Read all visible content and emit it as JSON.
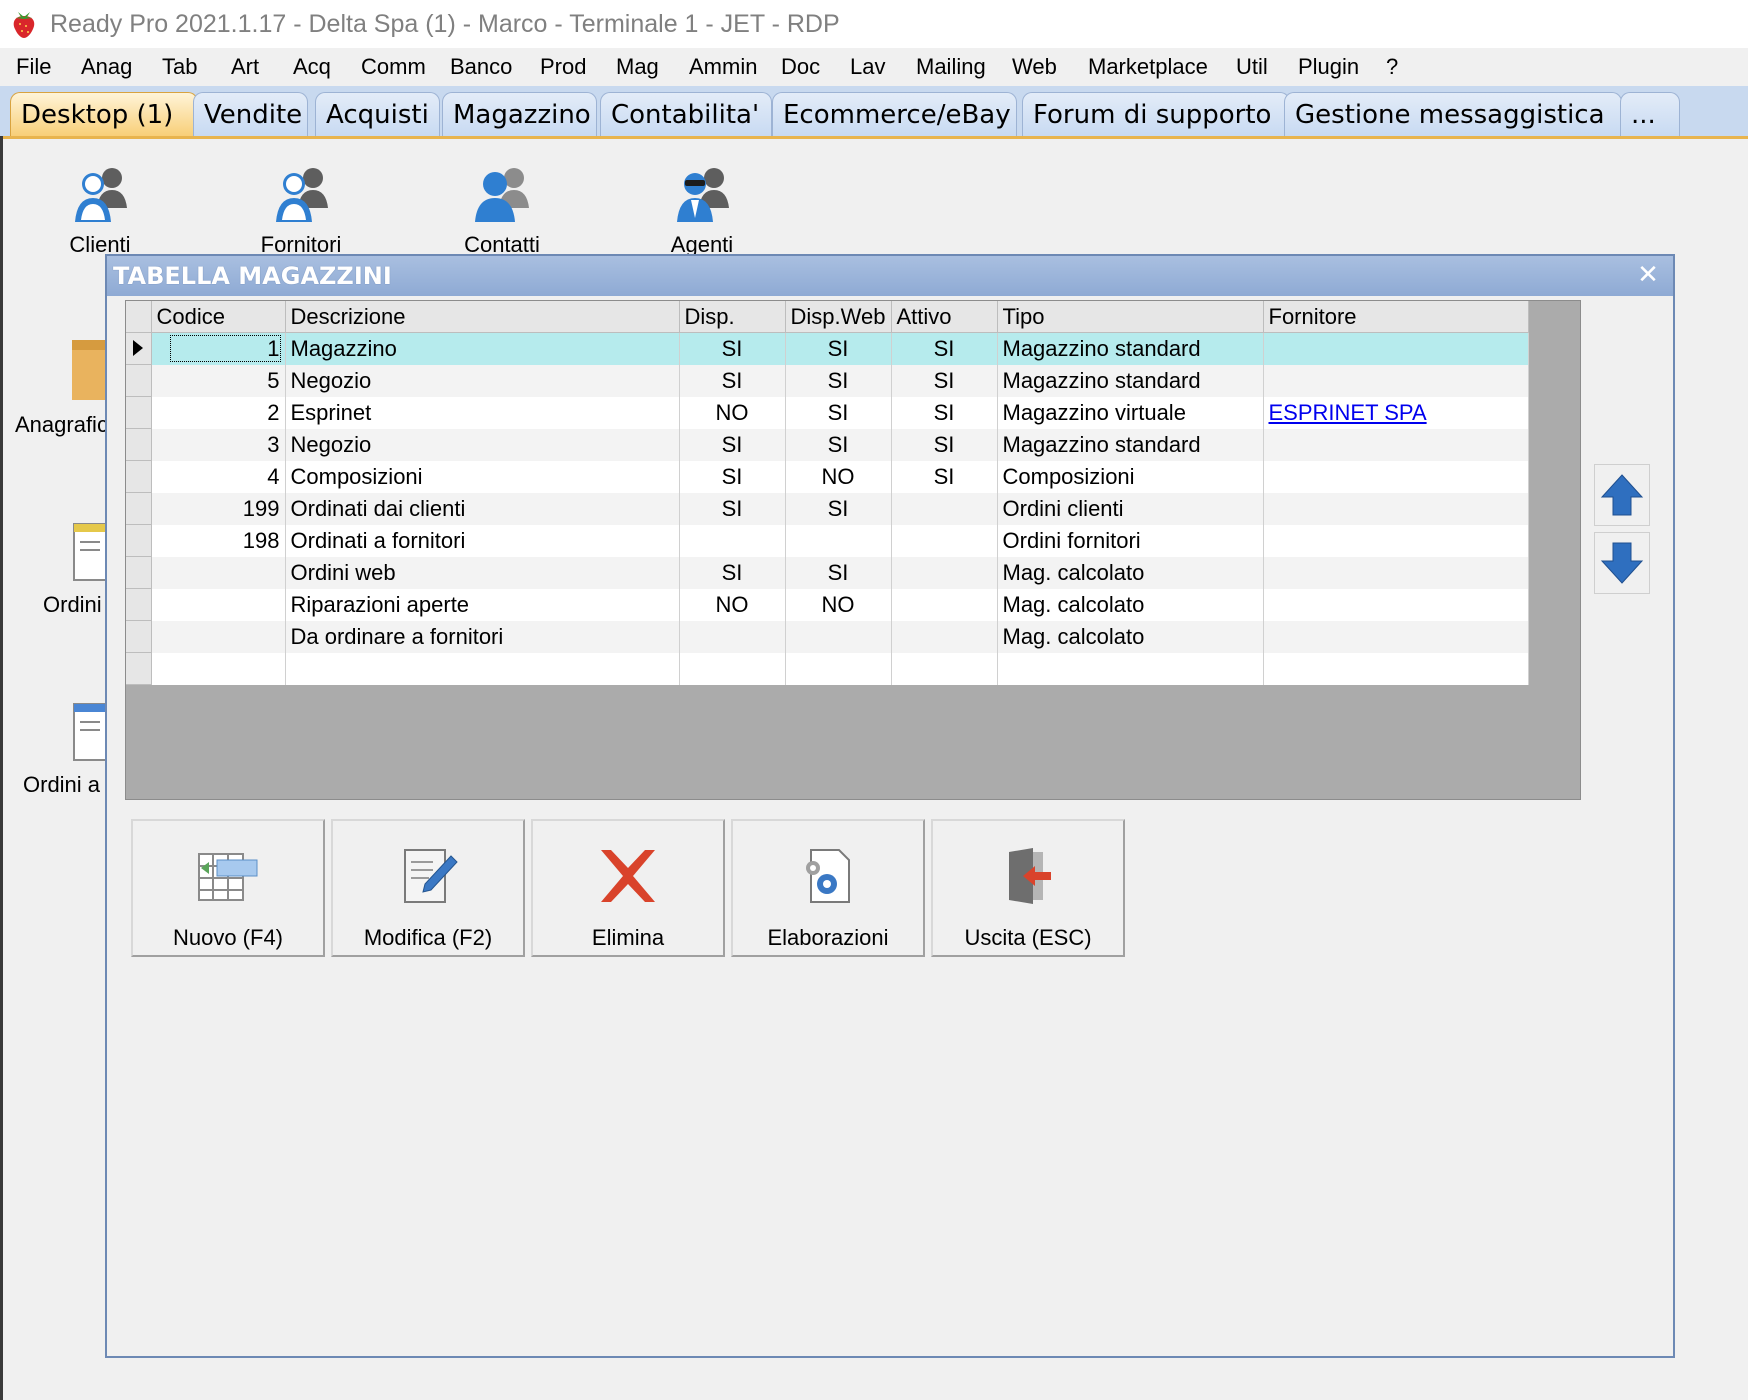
{
  "window": {
    "title": "Ready Pro 2021.1.17 - Delta Spa (1) - Marco - Terminale 1 - JET - RDP"
  },
  "menu": [
    "File",
    "Anag",
    "Tab",
    "Art",
    "Acq",
    "Comm",
    "Banco",
    "Prod",
    "Mag",
    "Ammin",
    "Doc",
    "Lav",
    "Mailing",
    "Web",
    "Marketplace",
    "Util",
    "Plugin",
    "?"
  ],
  "tabs": [
    "Desktop (1)",
    "Vendite",
    "Acquisti",
    "Magazzino",
    "Contabilita'",
    "Ecommerce/eBay",
    "Forum di supporto",
    "Gestione messaggistica",
    "..."
  ],
  "desktop_icons": {
    "clienti": "Clienti",
    "fornitori": "Fornitori",
    "contatti": "Contatti",
    "agenti": "Agenti",
    "anagrafiche": "Anagrafic",
    "ordini": "Ordini",
    "ordini_a": "Ordini a"
  },
  "dialog": {
    "title": "TABELLA MAGAZZINI",
    "columns": [
      "Codice",
      "Descrizione",
      "Disp.",
      "Disp.Web",
      "Attivo",
      "Tipo",
      "Fornitore"
    ],
    "rows": [
      {
        "codice": "1",
        "descrizione": "Magazzino",
        "disp": "SI",
        "disp_web": "SI",
        "attivo": "SI",
        "tipo": "Magazzino standard",
        "fornitore": ""
      },
      {
        "codice": "5",
        "descrizione": "Negozio",
        "disp": "SI",
        "disp_web": "SI",
        "attivo": "SI",
        "tipo": "Magazzino standard",
        "fornitore": ""
      },
      {
        "codice": "2",
        "descrizione": "Esprinet",
        "disp": "NO",
        "disp_web": "SI",
        "attivo": "SI",
        "tipo": "Magazzino virtuale",
        "fornitore": "ESPRINET SPA"
      },
      {
        "codice": "3",
        "descrizione": "Negozio",
        "disp": "SI",
        "disp_web": "SI",
        "attivo": "SI",
        "tipo": "Magazzino standard",
        "fornitore": ""
      },
      {
        "codice": "4",
        "descrizione": "Composizioni",
        "disp": "SI",
        "disp_web": "NO",
        "attivo": "SI",
        "tipo": "Composizioni",
        "fornitore": ""
      },
      {
        "codice": "199",
        "descrizione": "Ordinati dai clienti",
        "disp": "SI",
        "disp_web": "SI",
        "attivo": "",
        "tipo": "Ordini clienti",
        "fornitore": ""
      },
      {
        "codice": "198",
        "descrizione": "Ordinati a fornitori",
        "disp": "",
        "disp_web": "",
        "attivo": "",
        "tipo": "Ordini fornitori",
        "fornitore": ""
      },
      {
        "codice": "",
        "descrizione": "Ordini web",
        "disp": "SI",
        "disp_web": "SI",
        "attivo": "",
        "tipo": "Mag. calcolato",
        "fornitore": ""
      },
      {
        "codice": "",
        "descrizione": "Riparazioni aperte",
        "disp": "NO",
        "disp_web": "NO",
        "attivo": "",
        "tipo": "Mag. calcolato",
        "fornitore": ""
      },
      {
        "codice": "",
        "descrizione": "Da ordinare a fornitori",
        "disp": "",
        "disp_web": "",
        "attivo": "",
        "tipo": "Mag. calcolato",
        "fornitore": ""
      },
      {
        "codice": "",
        "descrizione": "",
        "disp": "",
        "disp_web": "",
        "attivo": "",
        "tipo": "",
        "fornitore": ""
      }
    ],
    "buttons": {
      "nuovo": "Nuovo (F4)",
      "modifica": "Modifica (F2)",
      "elimina": "Elimina",
      "elaborazioni": "Elaborazioni",
      "uscita": "Uscita (ESC)"
    }
  },
  "colors": {
    "selected_row": "#b6ebed",
    "active_tab": "#f8cf78",
    "tab_strip": "#c8d9ef",
    "dialog_title": "#8eaad4",
    "link": "#0000ee",
    "delete_red": "#d9432b",
    "arrow_blue": "#2f6fbf"
  },
  "icons": {
    "app": "strawberry-icon",
    "close": "close-icon",
    "up": "arrow-up-icon",
    "down": "arrow-down-icon",
    "nuovo": "new-table-icon",
    "modifica": "edit-document-icon",
    "elimina": "delete-x-icon",
    "elaborazioni": "gears-document-icon",
    "uscita": "exit-door-icon"
  }
}
